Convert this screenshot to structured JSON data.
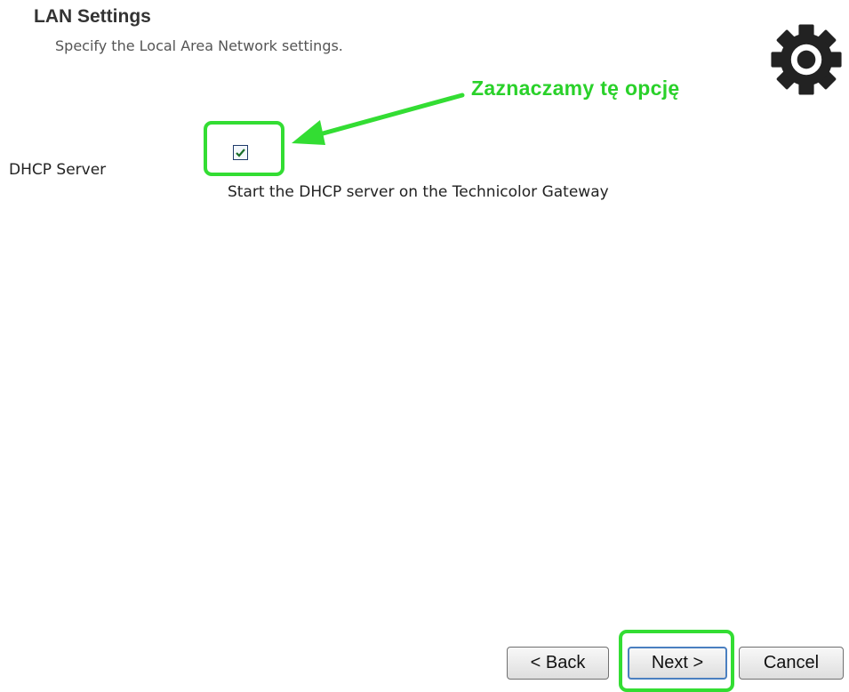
{
  "header": {
    "title": "LAN Settings",
    "subtitle": "Specify the Local Area Network settings.",
    "icon": "gear-icon"
  },
  "dhcp": {
    "label": "DHCP Server",
    "checked": true,
    "description": "Start the DHCP server on the Technicolor Gateway"
  },
  "annotation": {
    "text": "Zaznaczamy tę opcję",
    "color": "#2ad12a"
  },
  "buttons": {
    "back": "< Back",
    "next": "Next >",
    "cancel": "Cancel"
  }
}
